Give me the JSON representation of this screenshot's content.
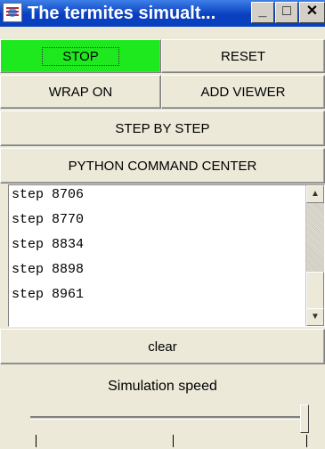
{
  "window": {
    "title": "The termites simualt...",
    "controls": {
      "minimize": "_",
      "maximize": "□",
      "close": "✕"
    }
  },
  "buttons": {
    "stop": "STOP",
    "reset": "RESET",
    "wrap": "WRAP ON",
    "add_viewer": "ADD VIEWER",
    "step_by_step": "STEP BY STEP",
    "python_command_center": "PYTHON COMMAND CENTER",
    "clear": "clear"
  },
  "log": {
    "lines": [
      "step 8706",
      "step 8770",
      "step 8834",
      "step 8898",
      "step 8961"
    ]
  },
  "speed": {
    "label": "Simulation speed",
    "value_fraction": 1.0
  },
  "colors": {
    "stop_button": "#1ee81e",
    "titlebar": "#0a3fbf",
    "background": "#ece9d8"
  },
  "icons": {
    "app": "python-app-icon",
    "scroll_up": "scroll-up-arrow-icon",
    "scroll_down": "scroll-down-arrow-icon"
  }
}
